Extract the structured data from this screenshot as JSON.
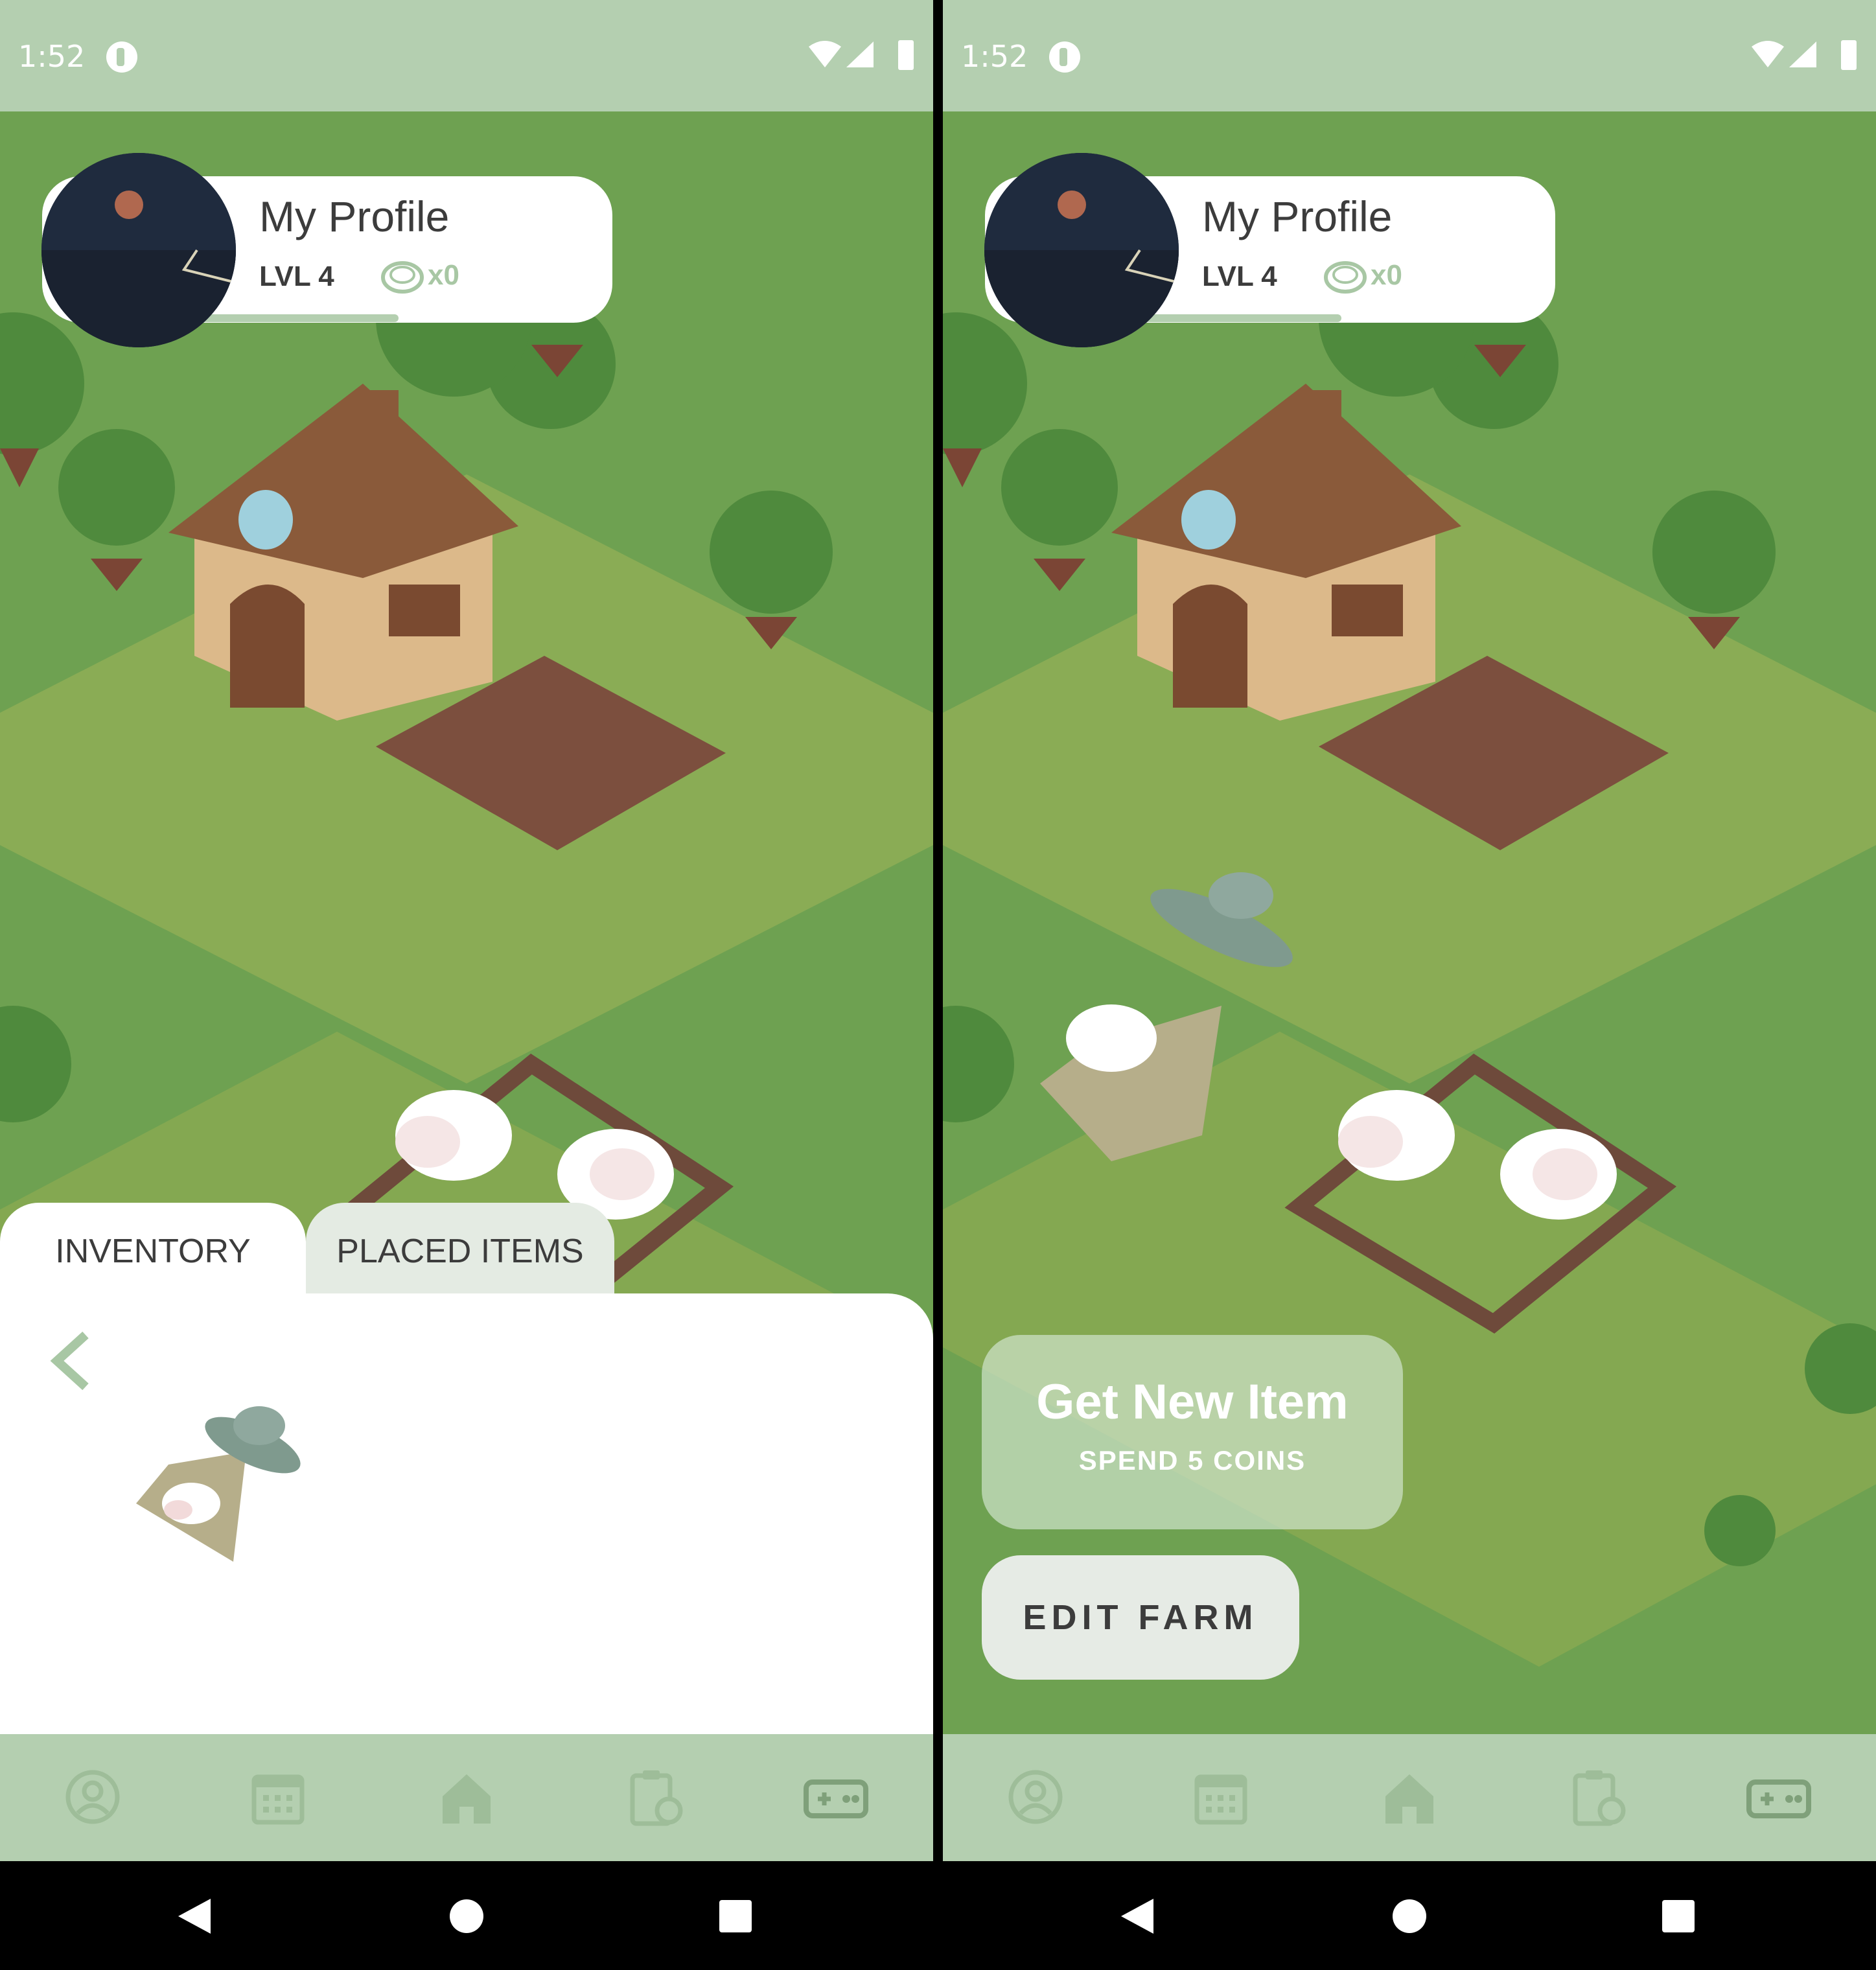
{
  "status_bar": {
    "time": "1:52"
  },
  "profile": {
    "name": "My Profile",
    "level": "LVL 4",
    "coins": "x0"
  },
  "inventory_screen": {
    "tab_inventory": "INVENTORY",
    "tab_placed": "PLACED ITEMS",
    "item_name": "ufo-cow-icon"
  },
  "farm_screen": {
    "get_new_item": "Get New Item",
    "get_new_item_sub": "SPEND 5 COINS",
    "edit_farm": "EDIT FARM"
  },
  "bottom_nav": [
    "profile-icon",
    "calendar-icon",
    "home-icon",
    "tasks-icon",
    "game-icon"
  ],
  "colors": {
    "grass": "#6ea151",
    "field": "#8fae55",
    "bar": "#b4cfb0",
    "accent": "#a8c7a4"
  }
}
